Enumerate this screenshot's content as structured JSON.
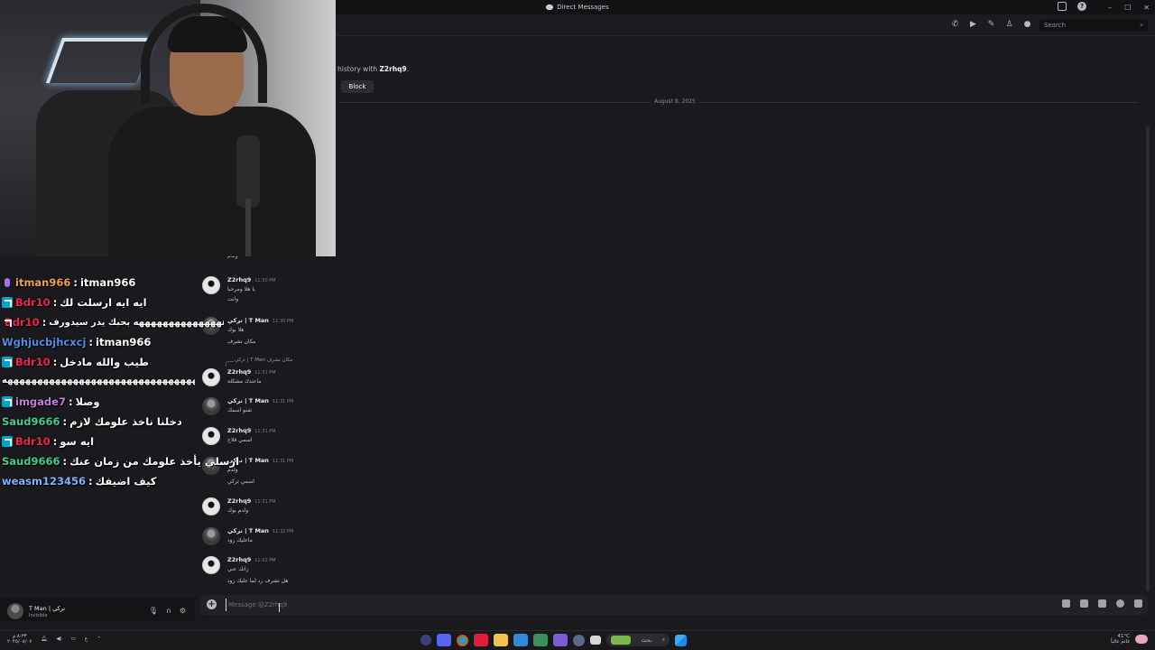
{
  "window": {
    "title": "Direct Messages"
  },
  "header": {
    "search_placeholder": "Search",
    "icons": [
      "phone-icon",
      "video-icon",
      "pin-icon",
      "add-friend-icon",
      "profile-icon"
    ]
  },
  "intro": {
    "prefix": "history with ",
    "username": "Z2rhq9",
    "suffix": ".",
    "block_label": "Block"
  },
  "date_divider": "August 8, 2025",
  "messages": [
    {
      "kind": "continuation",
      "lines": [
        "ولدم"
      ]
    },
    {
      "author": "Z2rhq9",
      "avatar": "white",
      "time": "11:30 PM",
      "lines": [
        "يا هلا ومرحبا",
        "وانت"
      ]
    },
    {
      "author": "تركي | T Man",
      "avatar": "photo",
      "time": "11:30 PM",
      "lines": [
        "هلا بوك",
        "مكان تشرف"
      ]
    },
    {
      "author": "Z2rhq9",
      "avatar": "white",
      "time": "11:31 PM",
      "reply_to": "تركي | T Man مكان تشرف",
      "lines": [
        "ماعندك مشكلة"
      ]
    },
    {
      "author": "تركي | T Man",
      "avatar": "photo",
      "time": "11:31 PM",
      "lines": [
        "شنو اسمك"
      ]
    },
    {
      "author": "Z2rhq9",
      "avatar": "white",
      "time": "11:31 PM",
      "lines": [
        "اسمي فلاح"
      ]
    },
    {
      "author": "تركي | T Man",
      "avatar": "photo",
      "time": "11:31 PM",
      "lines": [
        "ولدم",
        "اسمي تركي"
      ]
    },
    {
      "author": "Z2rhq9",
      "avatar": "white",
      "time": "11:31 PM",
      "lines": [
        "ولدم بوك"
      ]
    },
    {
      "author": "تركي | T Man",
      "avatar": "photo",
      "time": "11:32 PM",
      "lines": [
        "ماعليك زود"
      ]
    },
    {
      "author": "Z2rhq9",
      "avatar": "white",
      "time": "11:32 PM",
      "lines": [
        "زانك عني",
        "هل تشرف رد لما عليك زود"
      ]
    }
  ],
  "composer": {
    "placeholder": "Message @Z2rhq9"
  },
  "user_panel": {
    "name": "تركي | T Man",
    "status": "Invisible"
  },
  "twitch_chat": [
    {
      "badge": "mic",
      "user": "itman966",
      "user_color": "#f0a046",
      "text": "itman966"
    },
    {
      "badge": "vip",
      "user": "Bdr10",
      "user_color": "#e8264b",
      "text": "ايه ايه ارسلت لك"
    },
    {
      "badge": "vip",
      "user": "Bdr10",
      "user_color": "#e8264b",
      "text": "هههههههههههههههه بحبك يدر سيدورف"
    },
    {
      "badge": "none",
      "user": "Wghjucbjhcxcj",
      "user_color": "#4f8ee8",
      "text": "itman966"
    },
    {
      "badge": "vip",
      "user": "Bdr10",
      "user_color": "#e8264b",
      "text": "طيب والله مادخل"
    },
    {
      "badge": "none",
      "user": "",
      "user_color": "#ffffff",
      "text": "هههههههههههههههههههههههههههههههههه"
    },
    {
      "badge": "vip",
      "user": "imgade7",
      "user_color": "#c678dd",
      "text": "وصلا"
    },
    {
      "badge": "none",
      "user": "Saud9666",
      "user_color": "#3ccf8e",
      "text": "دخلنا ناخذ علومك لازم"
    },
    {
      "badge": "vip",
      "user": "Bdr10",
      "user_color": "#e8264b",
      "text": "ايه سو"
    },
    {
      "badge": "none",
      "user": "Saud9666",
      "user_color": "#3ccf8e",
      "text": "ارسلي يأخذ علومك من زمان عنك"
    },
    {
      "badge": "none",
      "user": "weasm123456",
      "user_color": "#7fb2ff",
      "text": "كيف اضيفك"
    }
  ],
  "taskbar": {
    "time": "٨:٣٣ م",
    "date": "٢٠٢٥/٠٨/٠٧",
    "lang": "ع",
    "search_label": "بحث",
    "weather_temp": "41°C",
    "weather_text": "غائم غالباً"
  },
  "colors": {
    "accent": "#5865f2",
    "vip_badge": "#00a3cc"
  }
}
